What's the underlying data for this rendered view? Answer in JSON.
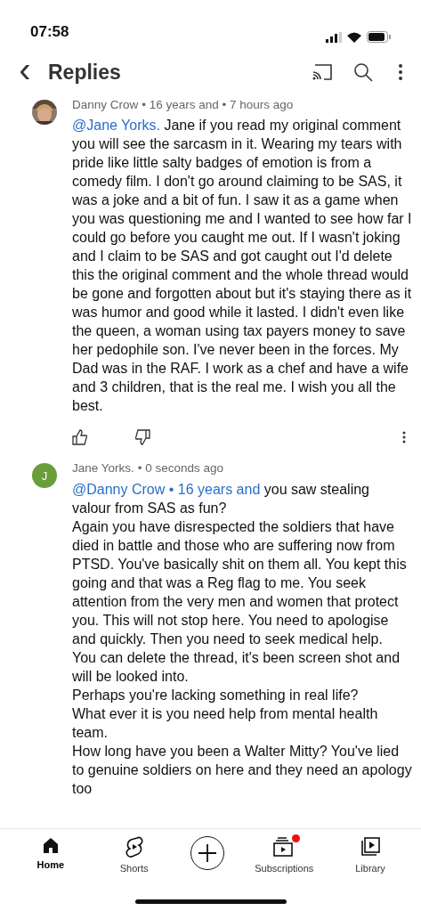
{
  "status_bar": {
    "time": "07:58"
  },
  "header": {
    "back_icon": "‹",
    "title": "Replies"
  },
  "comments": [
    {
      "author": "Danny Crow",
      "meta": "• 16 years and • 7 hours ago",
      "mention": "@Jane Yorks.",
      "text": "  Jane if you read my original comment you will see the sarcasm in it. Wearing my tears with pride like little salty badges of emotion is from a comedy film. I don't go around claiming to be SAS, it was a joke and a bit of fun. I saw it as a game when you was questioning me and I wanted to see how far I could go before you caught me out. If I wasn't joking and I claim to be SAS and got caught out I'd delete this the original comment and the whole thread would be gone and forgotten about but it's staying there as it was humor and good while it lasted. I didn't even like the queen, a woman using tax payers money to save her pedophile son. I've never been in the forces. My Dad was in the RAF. I work as a chef and have a wife and 3 children, that is the real me. I wish you all the best.",
      "actions": true
    },
    {
      "kind": "letter",
      "initial": "J",
      "color": "#6a9e3a",
      "author": "Jane Yorks.",
      "meta": "• 0 seconds ago",
      "mention": "@Danny Crow • 16 years and",
      "text": "  you saw stealing valour from SAS as fun?\nAgain you have disrespected the soldiers that have died in battle and those  who are suffering now from PTSD. You've basically shit on them all. You kept this going and that was a Reg flag to me. You seek attention from the very men and women that protect you. This will not stop here. You need to apologise and quickly. Then you need to seek medical help.\nYou can delete the thread, it's been screen shot and will be looked into.\nPerhaps you're lacking something in real life?\nWhat ever it is you need help from mental health team.\nHow long have you been a Walter Mitty? You've lied to genuine soldiers on here and they need an apology too",
      "actions": false
    }
  ],
  "nav": [
    {
      "kind": "home",
      "label": "Home",
      "selected": true
    },
    {
      "kind": "shorts",
      "label": "Shorts",
      "selected": false
    },
    {
      "kind": "create",
      "selected": false
    },
    {
      "kind": "subscriptions",
      "label": "Subscriptions",
      "selected": false,
      "badge": true
    },
    {
      "kind": "library",
      "label": "Library",
      "selected": false
    }
  ]
}
